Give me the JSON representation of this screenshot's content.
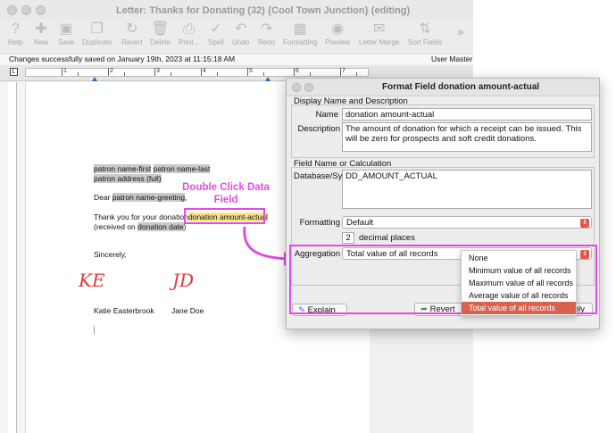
{
  "window": {
    "title": "Letter: Thanks for Donating (32) {Cool Town Junction} (editing)"
  },
  "toolbar": [
    {
      "label": "Help",
      "icon": "help-icon",
      "glyph": "?"
    },
    {
      "label": "New",
      "icon": "new-icon",
      "glyph": "✚"
    },
    {
      "label": "Save",
      "icon": "save-icon",
      "glyph": "▣"
    },
    {
      "label": "Duplicate",
      "icon": "duplicate-icon",
      "glyph": "❐"
    },
    {
      "label": "Revert",
      "icon": "revert-icon",
      "glyph": "↻"
    },
    {
      "label": "Delete",
      "icon": "trash-icon",
      "glyph": "🗑"
    },
    {
      "label": "Print...",
      "icon": "print-icon",
      "glyph": "⎙"
    },
    {
      "label": "Spell",
      "icon": "spell-icon",
      "glyph": "✓"
    },
    {
      "label": "Undo",
      "icon": "undo-icon",
      "glyph": "↶"
    },
    {
      "label": "Redo",
      "icon": "redo-icon",
      "glyph": "↷"
    },
    {
      "label": "Formatting",
      "icon": "formatting-icon",
      "glyph": "▦"
    },
    {
      "label": "Preview",
      "icon": "preview-icon",
      "glyph": "◉"
    },
    {
      "label": "Letter Merge",
      "icon": "letter-merge-icon",
      "glyph": "✉"
    },
    {
      "label": "Sort Fields",
      "icon": "sort-icon",
      "glyph": "⇅"
    }
  ],
  "status": {
    "message": "Changes successfully saved on January 19th, 2023 at 11:15:18 AM",
    "user": "User Master"
  },
  "ruler": {
    "numbers": [
      "1",
      "2",
      "3",
      "4",
      "5",
      "6",
      "7"
    ],
    "corner": "L"
  },
  "letter": {
    "line1a": "patron name-first",
    "line1b": "patron name-last",
    "line2": "patron address (full)",
    "dear": "Dear ",
    "greeting_field": "patron name-greeting",
    "greeting_end": ",",
    "thanks": "Thank you for your donation o",
    "amount_field": "donation amount-actual",
    "received": "(received on ",
    "date_field": "donation date",
    "received_end": ")",
    "sincerely": "Sincerely,",
    "signer1": "Katie Easterbrook",
    "signer2": "Jane Doe",
    "sig1": "KE",
    "sig2": "JD"
  },
  "annotation": {
    "line1": "Double Click Data",
    "line2": "Field"
  },
  "dialog": {
    "title": "Format Field donation amount-actual",
    "group1_title": "Display Name and Description",
    "name_label": "Name",
    "name_value": "donation amount-actual",
    "description_label": "Description",
    "description_value": "The amount of donation for which a receipt can be issued.  This will be zero for prospects and soft credit donations.",
    "group2_title": "Field Name or Calculation",
    "database_label": "Database/Sy",
    "database_value": "DD_AMOUNT_ACTUAL",
    "formatting_label": "Formatting",
    "formatting_value": "Default",
    "decimal_value": "2",
    "decimal_label": "decimal places",
    "aggregation_label": "Aggregation",
    "aggregation_value": "Total value of all records",
    "explain_label": "Explain",
    "revert_label": "Revert",
    "apply_fragment": "ply",
    "aggregation_options": [
      "None",
      "Minimum value of all records",
      "Maximum value of all records",
      "Average value of all records",
      "Total value of all records"
    ],
    "selected_option_index": 4
  },
  "colors": {
    "annotation": "#e24be0",
    "selected_option": "#d8624f",
    "field_highlight": "#fbe28a",
    "signature": "#e03a3a"
  }
}
